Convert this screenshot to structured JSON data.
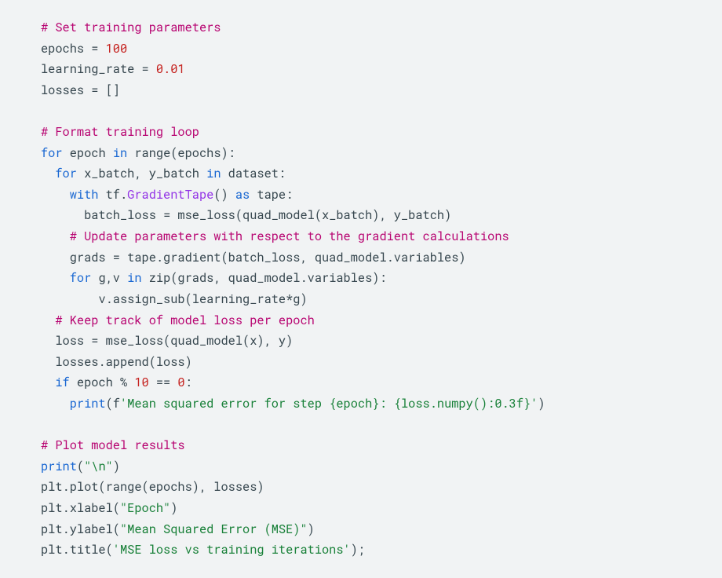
{
  "code": {
    "comment_training_params": "# Set training parameters",
    "line_epochs": {
      "var": "epochs ",
      "eq": "= ",
      "val": "100"
    },
    "line_lr": {
      "var": "learning_rate ",
      "eq": "= ",
      "val": "0.01"
    },
    "line_losses": {
      "var": "losses ",
      "eq": "= ",
      "brackets": "[]"
    },
    "comment_loop": "# Format training loop",
    "loop_for": "for",
    "loop_epoch": " epoch ",
    "loop_in": "in",
    "loop_range": " range(epochs):",
    "inner_for": "for",
    "inner_vars": " x_batch, y_batch ",
    "inner_in": "in",
    "inner_ds": " dataset:",
    "with_kw": "with",
    "with_tf": " tf.",
    "with_gt": "GradientTape",
    "with_paren": "() ",
    "as_kw": "as",
    "as_tape": " tape:",
    "bl_var": "batch_loss ",
    "bl_eq": "= ",
    "bl_expr": "mse_loss(quad_model(x_batch), y_batch)",
    "comment_update": "# Update parameters with respect to the gradient calculations",
    "grads_var": "grads ",
    "grads_eq": "= ",
    "grads_expr": "tape.gradient(batch_loss, quad_model.variables)",
    "for3_kw": "for",
    "for3_vars": " g,v ",
    "for3_in": "in",
    "for3_zip": " zip(grads, quad_model.variables):",
    "assign_expr": "v.assign_sub(learning_rate*g)",
    "comment_track": "# Keep track of model loss per epoch",
    "loss_var": "loss ",
    "loss_eq": "= ",
    "loss_expr": "mse_loss(quad_model(x), y)",
    "append_expr": "losses.append(loss)",
    "if_kw": "if",
    "if_cond1": " epoch % ",
    "if_ten": "10",
    "if_eqeq": " == ",
    "if_zero": "0",
    "if_colon": ":",
    "print_kw": "print",
    "print_open": "(f",
    "print_str": "'Mean squared error for step {epoch}: {loss.numpy():0.3f}'",
    "print_close": ")",
    "comment_plot": "# Plot model results",
    "print2_kw": "print",
    "print2_open": "(",
    "print2_str": "\"\\n\"",
    "print2_close": ")",
    "plot_expr": "plt.plot(range(epochs), losses)",
    "xlabel_pre": "plt.xlabel(",
    "xlabel_str": "\"Epoch\"",
    "xlabel_post": ")",
    "ylabel_pre": "plt.ylabel(",
    "ylabel_str": "\"Mean Squared Error (MSE)\"",
    "ylabel_post": ")",
    "title_pre": "plt.title(",
    "title_str": "'MSE loss vs training iterations'",
    "title_post": ");"
  }
}
